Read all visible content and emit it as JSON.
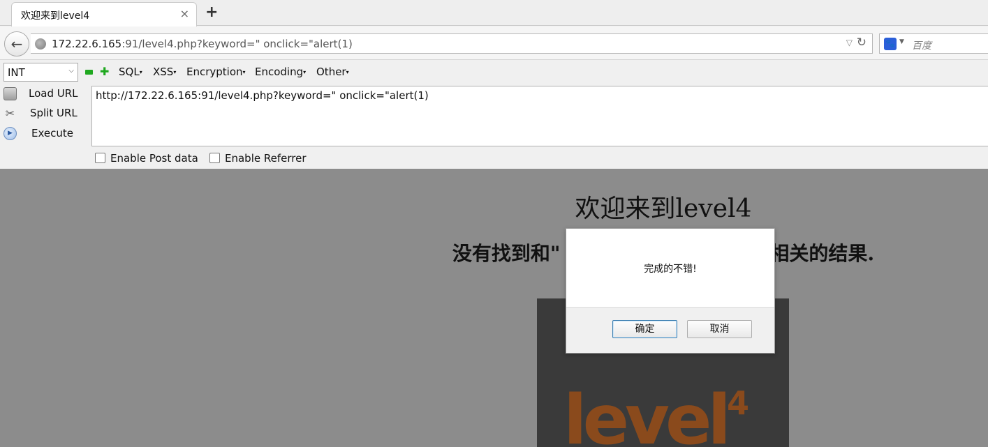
{
  "tab": {
    "title": "欢迎来到level4",
    "close": "×",
    "new_tab": "+"
  },
  "nav": {
    "back": "←",
    "url_host": "172.22.6.165",
    "url_rest": ":91/level4.php?keyword=\" onclick=\"alert(1)",
    "dropdown": "▽",
    "reload": "↻",
    "search_engine_icon": "baidu-paw-icon",
    "search_engine_glyph": "🐾",
    "search_dropdown": "▼",
    "search_placeholder": "百度"
  },
  "hackbar": {
    "select_value": "INT",
    "select_arrow": "⌵",
    "plus": "✚",
    "menus": [
      "SQL",
      "XSS",
      "Encryption",
      "Encoding",
      "Other"
    ],
    "caret": "▾",
    "buttons": {
      "load": "Load URL",
      "split": "Split URL",
      "execute": "Execute"
    },
    "split_glyph": "✂",
    "execute_glyph": "▶",
    "url_value": "http://172.22.6.165:91/level4.php?keyword=\" onclick=\"alert(1)",
    "checkboxes": {
      "post": "Enable Post data",
      "referrer": "Enable Referrer"
    }
  },
  "page": {
    "heading": "欢迎来到level4",
    "result_before": "没有找到和\"",
    "result_after": "相关的结果.",
    "logo_text": "level",
    "logo_sup": "4"
  },
  "dialog": {
    "message": "完成的不错!",
    "ok_label": "确定",
    "cancel_label": "取消"
  }
}
